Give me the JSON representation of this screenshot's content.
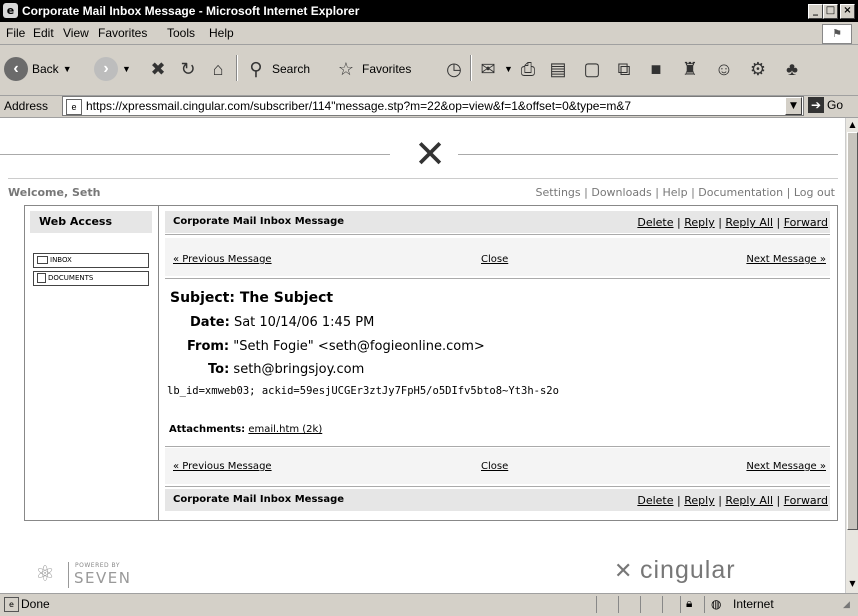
{
  "window": {
    "title": "Corporate Mail Inbox Message - Microsoft Internet Explorer",
    "app_icon": "ie-icon"
  },
  "menubar": {
    "file": "File",
    "edit": "Edit",
    "view": "View",
    "favorites": "Favorites",
    "tools": "Tools",
    "help": "Help"
  },
  "toolbar": {
    "back": "Back",
    "search": "Search",
    "favorites": "Favorites"
  },
  "address": {
    "label": "Address",
    "url": "https://xpressmail.cingular.com/subscriber/114\"message.stp?m=22&op=view&f=1&offset=0&type=m&7",
    "go": "Go"
  },
  "page": {
    "welcome": "Welcome, Seth",
    "top_links": {
      "settings": "Settings",
      "downloads": "Downloads",
      "help": "Help",
      "documentation": "Documentation",
      "logout": "Log out",
      "sep": "|"
    },
    "sidebar": {
      "title": "Web Access",
      "items": [
        {
          "label": "INBOX",
          "icon": "inbox-icon"
        },
        {
          "label": "DOCUMENTS",
          "icon": "documents-icon"
        }
      ]
    },
    "header_title": "Corporate Mail Inbox Message",
    "actions": {
      "delete": "Delete",
      "reply": "Reply",
      "reply_all": "Reply All",
      "forward": "Forward",
      "sep": "|"
    },
    "nav": {
      "previous": "« Previous Message",
      "close": "Close",
      "next": "Next Message »"
    },
    "message": {
      "subject_label": "Subject:",
      "subject_value": "The Subject",
      "date_label": "Date:",
      "date_value": "Sat 10/14/06 1:45 PM",
      "from_label": "From:",
      "from_value": "\"Seth Fogie\" <seth@fogieonline.com>",
      "to_label": "To:",
      "to_value": "seth@bringsjoy.com",
      "body": "lb_id=xmweb03; ackid=59esjUCGEr3ztJy7FpH5/o5DIfv5bto8~Yt3h-s2o",
      "attachments_label": "Attachments:",
      "attachment": "email.htm (2k)"
    },
    "footer": {
      "powered_by": "POWERED BY",
      "seven": "SEVEN",
      "cingular": "cingular"
    }
  },
  "status": {
    "text": "Done",
    "zone": "Internet"
  },
  "colors": {
    "titlebar": "#000000",
    "chrome": "#d4d0c8",
    "header_bar": "#e6e6e6"
  }
}
